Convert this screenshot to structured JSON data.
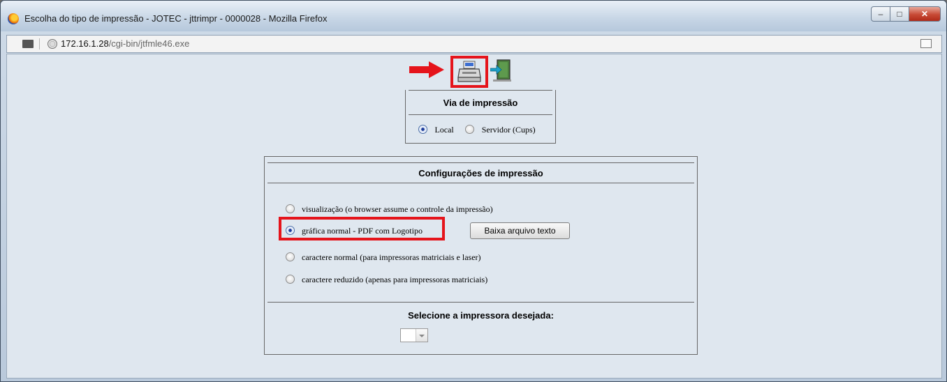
{
  "window": {
    "title": "Escolha do tipo de impressão - JOTEC - jttrimpr - 0000028 - Mozilla Firefox",
    "min_label": "–",
    "max_label": "□",
    "close_label": "✕"
  },
  "urlbar": {
    "host": "172.16.1.28",
    "path": "/cgi-bin/jtfmle46.exe"
  },
  "toolbar": {
    "icons": [
      "arrow-right-icon",
      "printer-icon",
      "exit-door-icon"
    ],
    "accent_color": "#e5141b"
  },
  "via": {
    "header": "Via de impressão",
    "options": [
      {
        "label": "Local",
        "selected": true
      },
      {
        "label": "Servidor (Cups)",
        "selected": false
      }
    ]
  },
  "config": {
    "header": "Configurações de impressão",
    "options": [
      {
        "label": "visualização (o browser assume o controle da impressão)",
        "selected": false
      },
      {
        "label": "gráfica normal - PDF com Logotipo",
        "selected": true
      },
      {
        "label": "caractere normal (para impressoras matriciais e laser)",
        "selected": false
      },
      {
        "label": "caractere reduzido (apenas para impressoras matriciais)",
        "selected": false
      }
    ],
    "download_button": "Baixa arquivo texto",
    "printer_header": "Selecione a impressora desejada:",
    "printer_selected": ""
  }
}
